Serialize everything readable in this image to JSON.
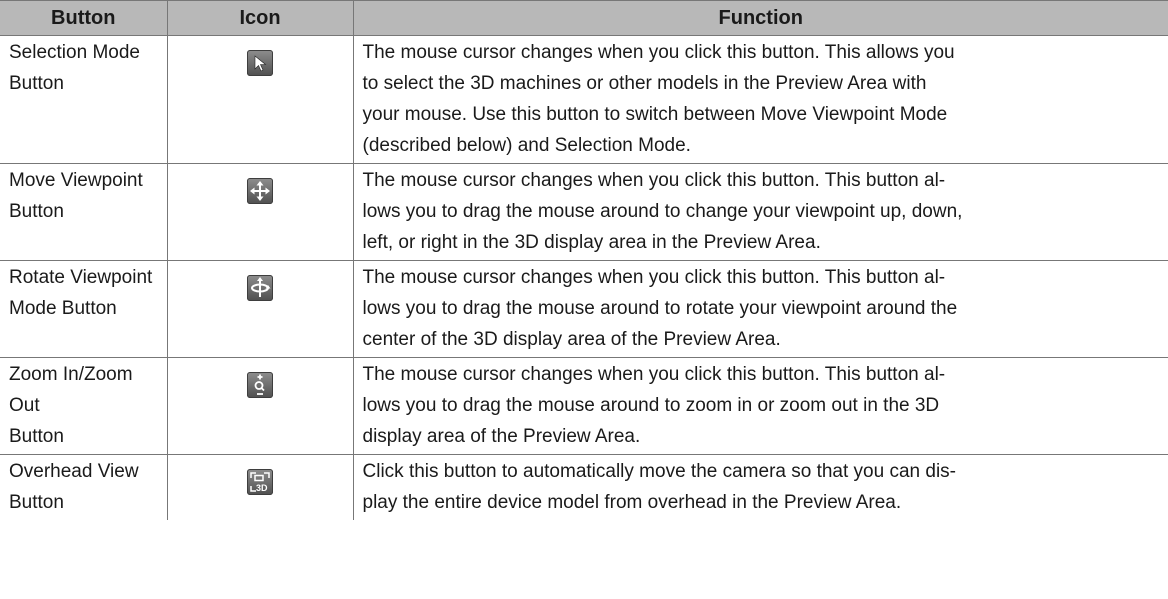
{
  "table": {
    "headers": [
      "Button",
      "Icon",
      "Function"
    ],
    "rows": [
      {
        "button": [
          "Selection Mode",
          "Button"
        ],
        "icon": "selection-arrow-icon",
        "function": [
          "The mouse cursor changes when you click this button. This allows you",
          "to select the 3D machines or other models in the Preview Area with",
          "your mouse. Use this button to switch between Move Viewpoint Mode",
          "(described below) and Selection Mode."
        ]
      },
      {
        "button": [
          "Move Viewpoint",
          "Button"
        ],
        "icon": "move-arrows-icon",
        "function": [
          "The mouse cursor changes when you click this button. This button al-",
          "lows you to drag the mouse around to change your viewpoint up, down,",
          "left, or right in the 3D display area in the Preview Area."
        ]
      },
      {
        "button": [
          "Rotate Viewpoint",
          "Mode Button"
        ],
        "icon": "rotate-viewpoint-icon",
        "function": [
          "The mouse cursor changes when you click this button. This button al-",
          "lows you to drag the mouse around to rotate your viewpoint around the",
          "center of the 3D display area of the Preview Area."
        ]
      },
      {
        "button": [
          "Zoom In/Zoom Out",
          "Button"
        ],
        "icon": "zoom-icon",
        "function": [
          "The mouse cursor changes when you click this button. This button al-",
          "lows you to drag the mouse around to zoom in or zoom out in the 3D",
          "display area of the Preview Area."
        ]
      },
      {
        "button": [
          "Overhead View",
          "Button"
        ],
        "icon": "overhead-view-3d-icon",
        "function": [
          "Click this button to automatically move the camera so that you can dis-",
          "play the entire device model from overhead in the Preview Area."
        ]
      }
    ]
  },
  "colors": {
    "header_bg": "#b8b8b8",
    "border": "#777777",
    "icon_bg": "#5a5a5a"
  }
}
